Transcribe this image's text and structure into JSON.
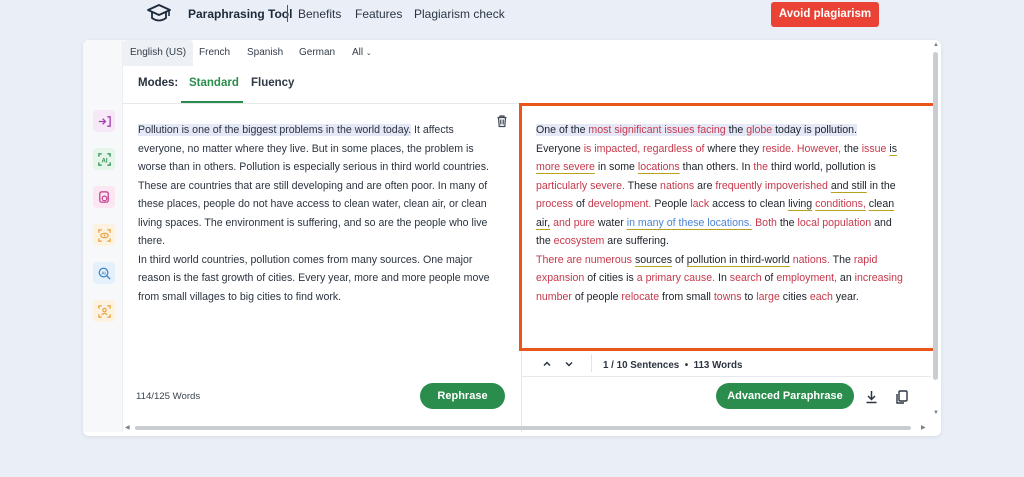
{
  "header": {
    "brand": "Paraphrasing Tool",
    "nav": [
      "Benefits",
      "Features",
      "Plagiarism check"
    ],
    "cta": "Avoid plagiarism"
  },
  "languages": [
    "English (US)",
    "French",
    "Spanish",
    "German",
    "All"
  ],
  "modes": {
    "label": "Modes:",
    "items": [
      "Standard",
      "Fluency"
    ],
    "active": "Standard"
  },
  "input": {
    "highlighted": "Pollution is one of the biggest problems in the world today.",
    "para1_rest": " It affects everyone, no matter where they live. But in some places, the problem is worse than in others. Pollution is especially serious in third world countries. These are countries that are still developing and are often poor. In many of these places, people do not have access to clean water, clean air, or clean living spaces. The environment is suffering, and so are the people who live there.",
    "para2": "In third world countries, pollution comes from many sources. One major reason is the fast growth of cities. Every year, more and more people move from small villages to big cities to find work.",
    "word_count": "114/125 Words",
    "rephrase_label": "Rephrase"
  },
  "output": {
    "s1": [
      "One of the ",
      "most significant issues facing",
      " the ",
      "globe",
      " today is pollution."
    ],
    "s2": [
      "Everyone ",
      "is impacted, regardless of",
      " where they ",
      "reside.",
      " ",
      "However,",
      " the ",
      "issue",
      " ",
      "is",
      " ",
      "more severe",
      " in some ",
      "locations",
      " than others."
    ],
    "s3": [
      "In ",
      "the",
      " third world, pollution is ",
      "particularly severe.",
      " These ",
      "nations",
      " are ",
      "frequently impoverished",
      " ",
      "and still",
      " in the ",
      "process",
      " of ",
      "development.",
      " People ",
      "lack",
      " access to clean ",
      "living",
      " ",
      "conditions,",
      " ",
      "clean air,",
      " ",
      "and pure",
      " water ",
      "in many of these locations.",
      " ",
      "Both",
      " the ",
      "local population",
      " and the ",
      "ecosystem",
      " are suffering."
    ],
    "s4": [
      "There are numerous",
      " ",
      "sources",
      " of ",
      "pollution in third-world",
      " ",
      "nations.",
      " The ",
      "rapid expansion",
      " of cities is ",
      "a",
      " ",
      "primary cause.",
      " In ",
      "search",
      " of ",
      "employment,",
      " an ",
      "increasing number",
      " of people ",
      "relocate",
      " from small ",
      "towns",
      " to ",
      "large",
      " cities ",
      "each",
      " year."
    ],
    "sentence_info": "1 / 10 Sentences",
    "words_info": "113 Words",
    "advanced_label": "Advanced Paraphrase"
  },
  "colors": {
    "green": "#2a8d4d",
    "red_cta": "#ea4335",
    "orange_frame": "#e8561a",
    "changed_word": "#c6394c",
    "structure_change": "#4b83d4"
  }
}
